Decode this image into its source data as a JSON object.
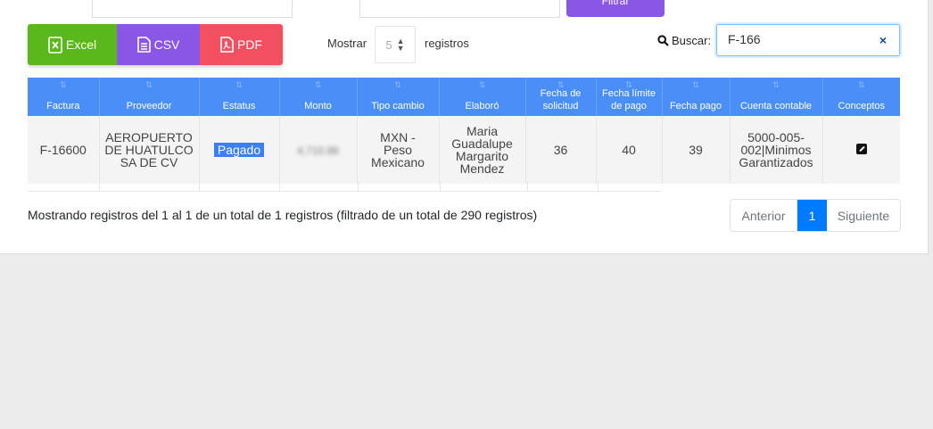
{
  "top": {
    "partial_button_label": "Filtrar"
  },
  "export": {
    "excel_label": "Excel",
    "csv_label": "CSV",
    "pdf_label": "PDF"
  },
  "length": {
    "show_label": "Mostrar",
    "value": "5",
    "records_label": "registros"
  },
  "search": {
    "label": "Buscar:",
    "value": "F-166",
    "clear_label": "×"
  },
  "table": {
    "headers": [
      {
        "line1": "Factura",
        "line2": ""
      },
      {
        "line1": "Proveedor",
        "line2": ""
      },
      {
        "line1": "Estatus",
        "line2": ""
      },
      {
        "line1": "Monto",
        "line2": ""
      },
      {
        "line1": "Tipo cambio",
        "line2": ""
      },
      {
        "line1": "Elaboró",
        "line2": ""
      },
      {
        "line1": "Fecha de",
        "line2": "solicitud"
      },
      {
        "line1": "Fecha límite",
        "line2": "de pago"
      },
      {
        "line1": "Fecha pago",
        "line2": ""
      },
      {
        "line1": "Cuenta contable",
        "line2": ""
      },
      {
        "line1": "Conceptos",
        "line2": ""
      }
    ],
    "row": {
      "factura": "F-16600",
      "proveedor": [
        "AEROPUERTO",
        "DE HUATULCO",
        "SA DE CV"
      ],
      "estatus": "Pagado",
      "monto": "4,710.88",
      "tipo_cambio": [
        "MXN -",
        "Peso",
        "Mexicano"
      ],
      "elaboro": [
        "Maria",
        "Guadalupe",
        "Margarito",
        "Mendez"
      ],
      "fecha_solicitud": "36",
      "fecha_limite": "40",
      "fecha_pago": "39",
      "cuenta": [
        "5000-005-",
        "002|Minimos",
        "Garantizados"
      ]
    }
  },
  "info": "Mostrando registros del 1 al 1 de un total de 1 registros (filtrado de un total de 290 registros)",
  "pagination": {
    "previous": "Anterior",
    "current": "1",
    "next": "Siguiente"
  },
  "colors": {
    "excel": "#5bb81a",
    "csv": "#8a56e6",
    "pdf": "#f25061",
    "header": "#4a8ff7",
    "badge": "#3b7ff0",
    "page_active": "#007bff"
  }
}
